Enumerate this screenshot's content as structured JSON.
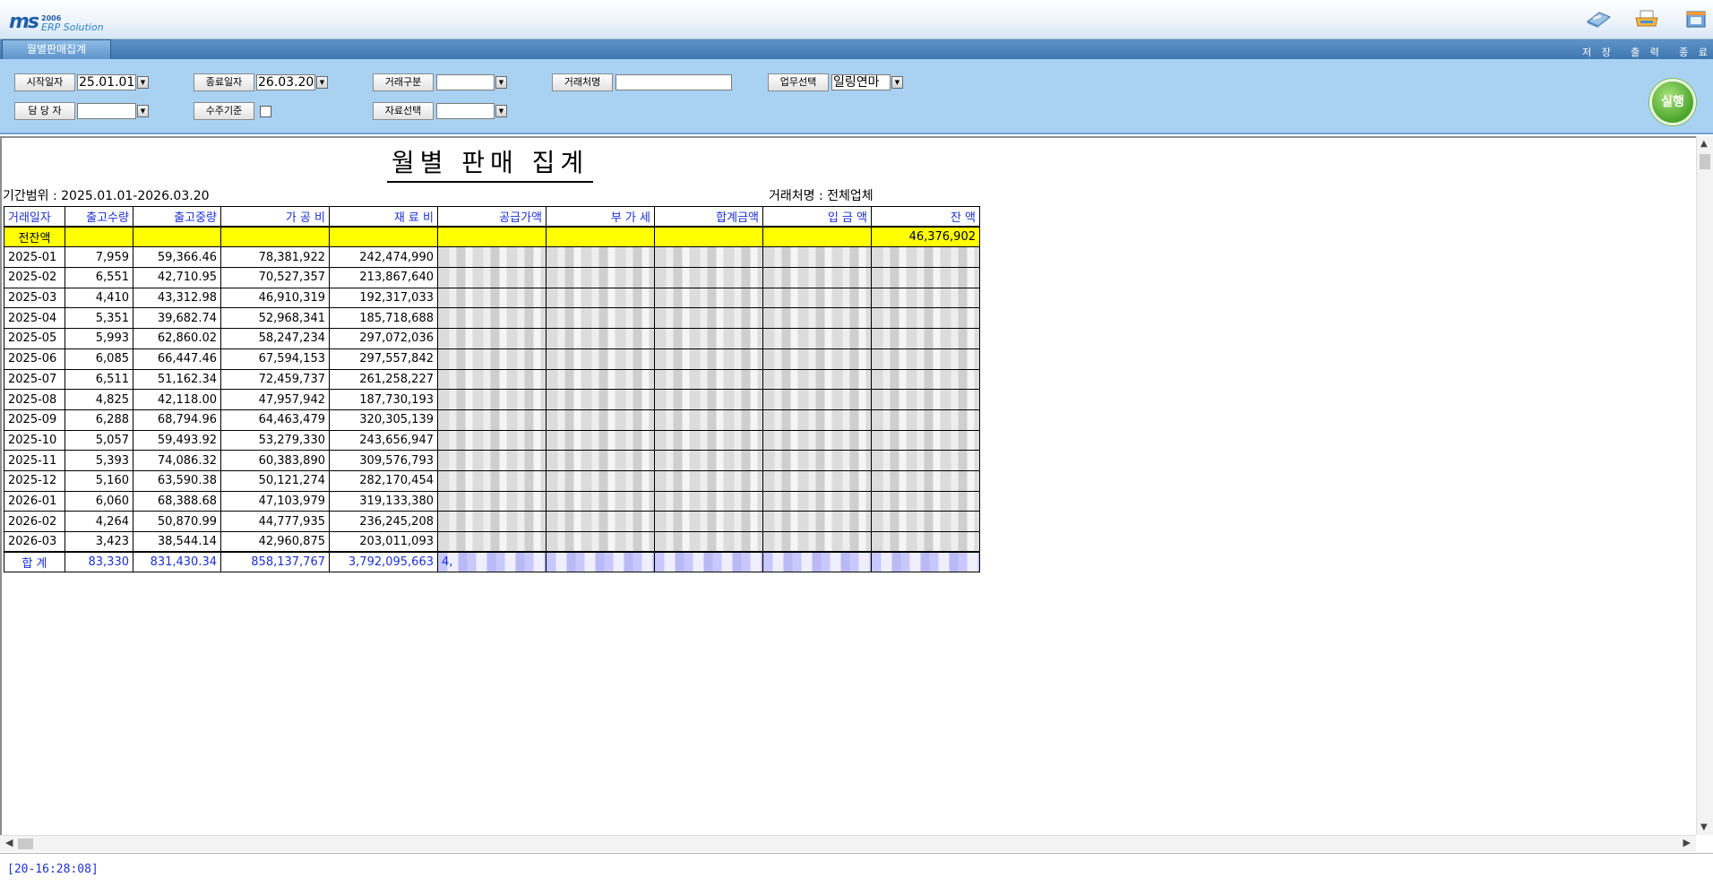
{
  "app": {
    "logo_mark": "ms",
    "logo_year": "2006",
    "logo_product": "ERP Solution"
  },
  "toolbar": {
    "save_label": "저 장",
    "print_label": "출 력",
    "exit_label": "종 료"
  },
  "menu": {
    "active_tab": "월별판매집계"
  },
  "filters": {
    "start_date_label": "시작일자",
    "start_date_value": "25.01.01",
    "end_date_label": "종료일자",
    "end_date_value": "26.03.20",
    "trade_type_label": "거래구분",
    "trade_type_value": "",
    "customer_label": "거래처명",
    "customer_value": "",
    "business_label": "업무선택",
    "business_value": "일링연마",
    "manager_label": "담 당 자",
    "manager_value": "",
    "order_basis_label": "수주기준",
    "data_select_label": "자료선택",
    "data_select_value": "",
    "run_label": "실행"
  },
  "report": {
    "title": "월별 판매 집계",
    "period": "기간범위 : 2025.01.01-2026.03.20",
    "customer": "거래처명 : 전체업체",
    "columns": [
      "거래일자",
      "출고수량",
      "출고중량",
      "가 공 비",
      "재 료 비",
      "공급가액",
      "부 가 세",
      "합계금액",
      "입 금 액",
      "잔 액"
    ],
    "opening_label": "전잔액",
    "opening_balance": "46,376,902",
    "rows": [
      {
        "date": "2025-01",
        "qty": "7,959",
        "weight": "59,366.46",
        "proc": "78,381,922",
        "mat": "242,474,990"
      },
      {
        "date": "2025-02",
        "qty": "6,551",
        "weight": "42,710.95",
        "proc": "70,527,357",
        "mat": "213,867,640"
      },
      {
        "date": "2025-03",
        "qty": "4,410",
        "weight": "43,312.98",
        "proc": "46,910,319",
        "mat": "192,317,033"
      },
      {
        "date": "2025-04",
        "qty": "5,351",
        "weight": "39,682.74",
        "proc": "52,968,341",
        "mat": "185,718,688"
      },
      {
        "date": "2025-05",
        "qty": "5,993",
        "weight": "62,860.02",
        "proc": "58,247,234",
        "mat": "297,072,036"
      },
      {
        "date": "2025-06",
        "qty": "6,085",
        "weight": "66,447.46",
        "proc": "67,594,153",
        "mat": "297,557,842"
      },
      {
        "date": "2025-07",
        "qty": "6,511",
        "weight": "51,162.34",
        "proc": "72,459,737",
        "mat": "261,258,227"
      },
      {
        "date": "2025-08",
        "qty": "4,825",
        "weight": "42,118.00",
        "proc": "47,957,942",
        "mat": "187,730,193"
      },
      {
        "date": "2025-09",
        "qty": "6,288",
        "weight": "68,794.96",
        "proc": "64,463,479",
        "mat": "320,305,139"
      },
      {
        "date": "2025-10",
        "qty": "5,057",
        "weight": "59,493.92",
        "proc": "53,279,330",
        "mat": "243,656,947"
      },
      {
        "date": "2025-11",
        "qty": "5,393",
        "weight": "74,086.32",
        "proc": "60,383,890",
        "mat": "309,576,793"
      },
      {
        "date": "2025-12",
        "qty": "5,160",
        "weight": "63,590.38",
        "proc": "50,121,274",
        "mat": "282,170,454"
      },
      {
        "date": "2026-01",
        "qty": "6,060",
        "weight": "68,388.68",
        "proc": "47,103,979",
        "mat": "319,133,380"
      },
      {
        "date": "2026-02",
        "qty": "4,264",
        "weight": "50,870.99",
        "proc": "44,777,935",
        "mat": "236,245,208"
      },
      {
        "date": "2026-03",
        "qty": "3,423",
        "weight": "38,544.14",
        "proc": "42,960,875",
        "mat": "203,011,093"
      }
    ],
    "total_label": "합 계",
    "total": {
      "qty": "83,330",
      "weight": "831,430.34",
      "proc": "858,137,767",
      "mat": "3,792,095,663",
      "supply_partial": "4,"
    }
  },
  "status": {
    "message": "[20-16:28:08]"
  },
  "colors": {
    "header_text_blue": "#1a2fd6",
    "opening_row_yellow": "#ffff00",
    "filter_panel_blue": "#a9d1f2",
    "run_button_green": "#4aa52b"
  }
}
